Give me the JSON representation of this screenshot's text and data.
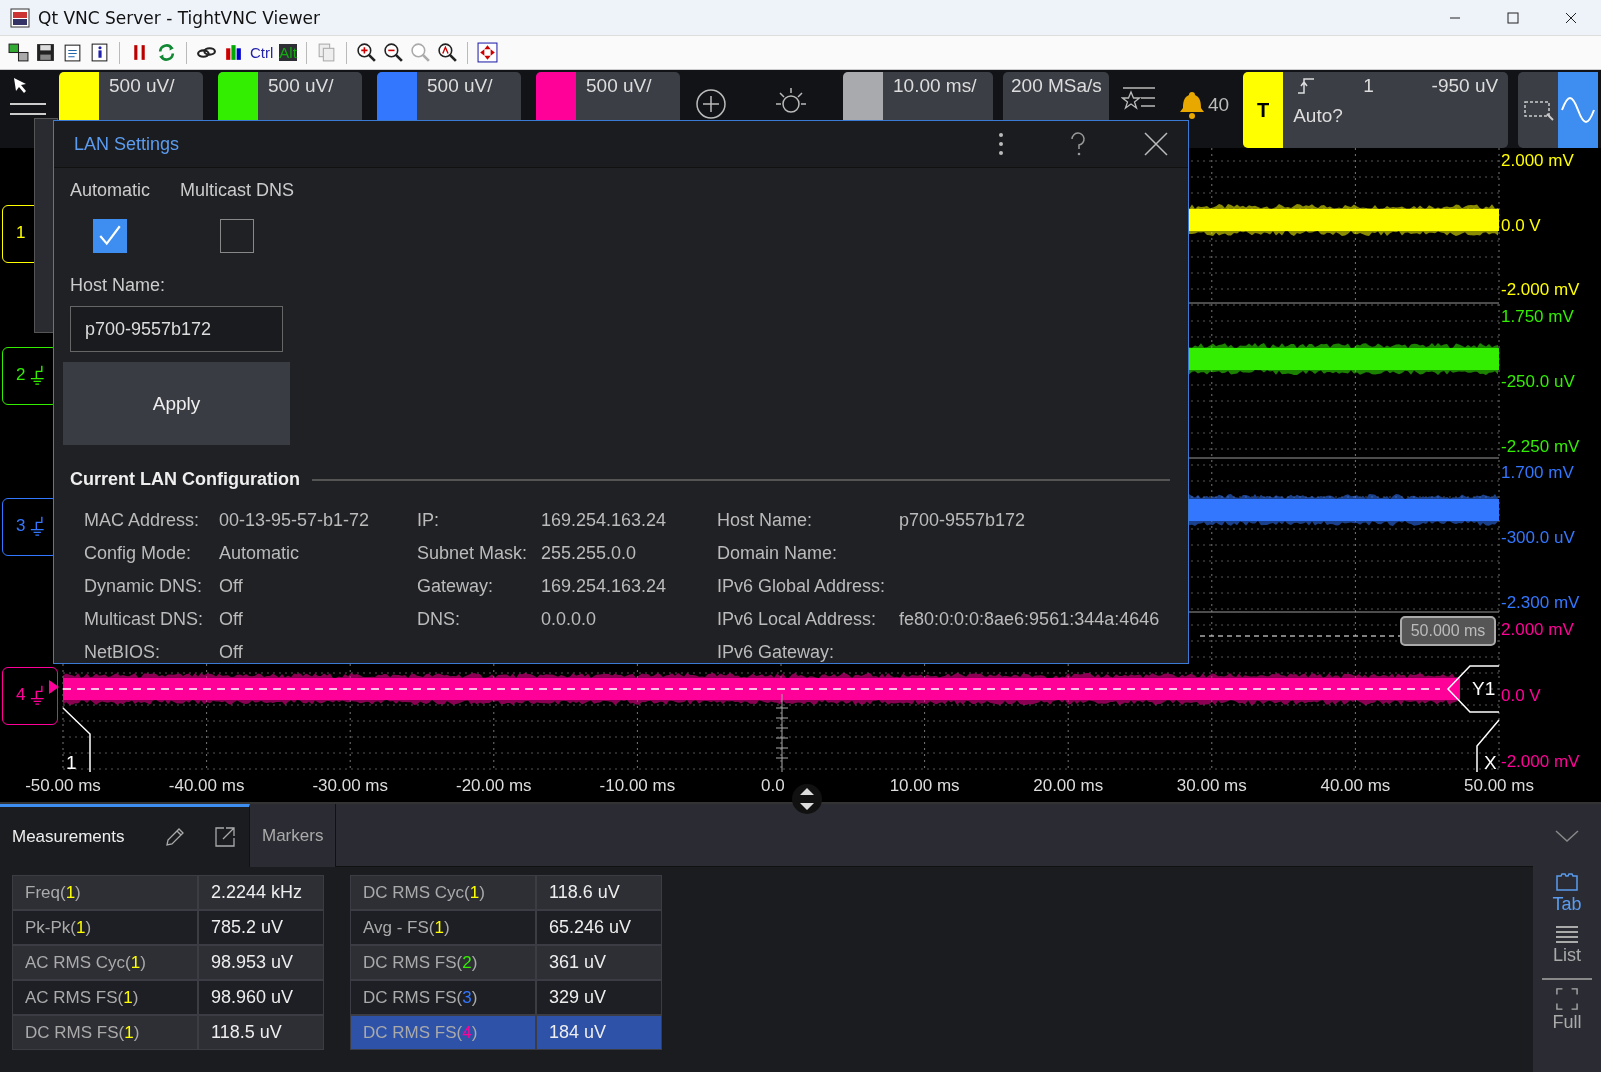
{
  "window": {
    "title": "Qt VNC Server - TightVNC Viewer"
  },
  "toolbar": {
    "ctrl_label": "Ctrl",
    "alt_label": "Alt"
  },
  "channels": [
    {
      "scale": "500 uV/",
      "color": "#ffff00"
    },
    {
      "scale": "500 uV/",
      "color": "#33ee00"
    },
    {
      "scale": "500 uV/",
      "color": "#3377ff"
    },
    {
      "scale": "500 uV/",
      "color": "#ff0099"
    }
  ],
  "horizontal": {
    "scale": "10.00 ms/"
  },
  "acquisition": {
    "sample_rate": "200 MSa/s"
  },
  "alerts": {
    "count": "40"
  },
  "trigger": {
    "label": "T",
    "source": "1",
    "level": "-950 uV",
    "mode": "Auto?"
  },
  "plot": {
    "channel_markers": [
      {
        "number": "1",
        "kind": "plain",
        "color": "#ffff00"
      },
      {
        "number": "2",
        "kind": "ground",
        "color": "#33ee00"
      },
      {
        "number": "3",
        "kind": "ground",
        "color": "#3377ff"
      },
      {
        "number": "4",
        "kind": "ground_arrow",
        "color": "#ff0099"
      }
    ],
    "axis_labels": [
      {
        "text": "2.000 mV",
        "color": "#ffff00"
      },
      {
        "text": "0.0 V",
        "color": "#ffff00"
      },
      {
        "text": "-2.000 mV",
        "color": "#ffff00"
      },
      {
        "text": "1.750 mV",
        "color": "#33ee00"
      },
      {
        "text": "-250.0 uV",
        "color": "#33ee00"
      },
      {
        "text": "-2.250 mV",
        "color": "#33ee00"
      },
      {
        "text": "1.700 mV",
        "color": "#3377ff"
      },
      {
        "text": "-300.0 uV",
        "color": "#3377ff"
      },
      {
        "text": "-2.300 mV",
        "color": "#3377ff"
      },
      {
        "text": "2.000 mV",
        "color": "#ff0099"
      },
      {
        "text": "0.0 V",
        "color": "#ff0099"
      },
      {
        "text": "-2.000 mV",
        "color": "#ff0099"
      }
    ],
    "time_labels": [
      "-50.00 ms",
      "-40.00 ms",
      "-30.00 ms",
      "-20.00 ms",
      "-10.00 ms",
      "0.0",
      "10.00 ms",
      "20.00 ms",
      "30.00 ms",
      "40.00 ms",
      "50.00 ms"
    ],
    "cursor_time": "50.000 ms",
    "cursor_y": "Y1",
    "cursor_x": "X",
    "cursor_marker": "1"
  },
  "dialog": {
    "title": "LAN Settings",
    "options": [
      {
        "label": "Automatic",
        "checked": true
      },
      {
        "label": "Multicast DNS",
        "checked": false
      }
    ],
    "host_label": "Host Name:",
    "host_value": "p700-9557b172",
    "apply": "Apply",
    "section": "Current LAN Configuration",
    "columns": [
      {
        "rows": [
          {
            "label": "MAC Address:",
            "value": "00-13-95-57-b1-72"
          },
          {
            "label": "Config Mode:",
            "value": "Automatic"
          },
          {
            "label": "Dynamic DNS:",
            "value": "Off"
          },
          {
            "label": "Multicast DNS:",
            "value": "Off"
          },
          {
            "label": "NetBIOS:",
            "value": "Off"
          }
        ]
      },
      {
        "rows": [
          {
            "label": "IP:",
            "value": "169.254.163.24"
          },
          {
            "label": "Subnet Mask:",
            "value": "255.255.0.0"
          },
          {
            "label": "Gateway:",
            "value": "169.254.163.24"
          },
          {
            "label": "DNS:",
            "value": "0.0.0.0"
          }
        ]
      },
      {
        "rows": [
          {
            "label": "Host Name:",
            "value": "p700-9557b172"
          },
          {
            "label": "Domain Name:"
          },
          {
            "label": "IPv6 Global Address:"
          },
          {
            "label": "IPv6 Local Address:",
            "value": "fe80:0:0:0:8ae6:9561:344a:4646"
          },
          {
            "label": "IPv6 Gateway:"
          }
        ]
      }
    ]
  },
  "bottom": {
    "tabs": [
      {
        "label": "Measurements",
        "selected": true
      },
      {
        "label": "Markers",
        "selected": false
      }
    ],
    "tables": [
      {
        "rows": [
          {
            "prefix": "Freq(",
            "source": "1",
            "suffix": ")",
            "color": "#ffff00",
            "value": "2.2244 kHz",
            "selected": false
          },
          {
            "prefix": "Pk-Pk(",
            "source": "1",
            "suffix": ")",
            "color": "#ffff00",
            "value": "785.2 uV",
            "selected": false
          },
          {
            "prefix": "AC RMS Cyc(",
            "source": "1",
            "suffix": ")",
            "color": "#ffff00",
            "value": "98.953 uV",
            "selected": false
          },
          {
            "prefix": "AC RMS FS(",
            "source": "1",
            "suffix": ")",
            "color": "#ffff00",
            "value": "98.960 uV",
            "selected": false
          },
          {
            "prefix": "DC RMS FS(",
            "source": "1",
            "suffix": ")",
            "color": "#ffff00",
            "value": "118.5 uV",
            "selected": false
          }
        ]
      },
      {
        "rows": [
          {
            "prefix": "DC RMS Cyc(",
            "source": "1",
            "suffix": ")",
            "color": "#ffff00",
            "value": "118.6 uV",
            "selected": false
          },
          {
            "prefix": "Avg - FS(",
            "source": "1",
            "suffix": ")",
            "color": "#ffff00",
            "value": "65.246 uV",
            "selected": false
          },
          {
            "prefix": "DC RMS FS(",
            "source": "2",
            "suffix": ")",
            "color": "#33ee00",
            "value": "361 uV",
            "selected": false
          },
          {
            "prefix": "DC RMS FS(",
            "source": "3",
            "suffix": ")",
            "color": "#3377ff",
            "value": "329 uV",
            "selected": false
          },
          {
            "prefix": "DC RMS FS(",
            "source": "4",
            "suffix": ")",
            "color": "#ff0099",
            "value": "184 uV",
            "selected": true
          }
        ]
      }
    ],
    "views": [
      {
        "label": "Tab",
        "selected": true
      },
      {
        "label": "List",
        "selected": false
      },
      {
        "label": "Full",
        "selected": false
      }
    ]
  }
}
